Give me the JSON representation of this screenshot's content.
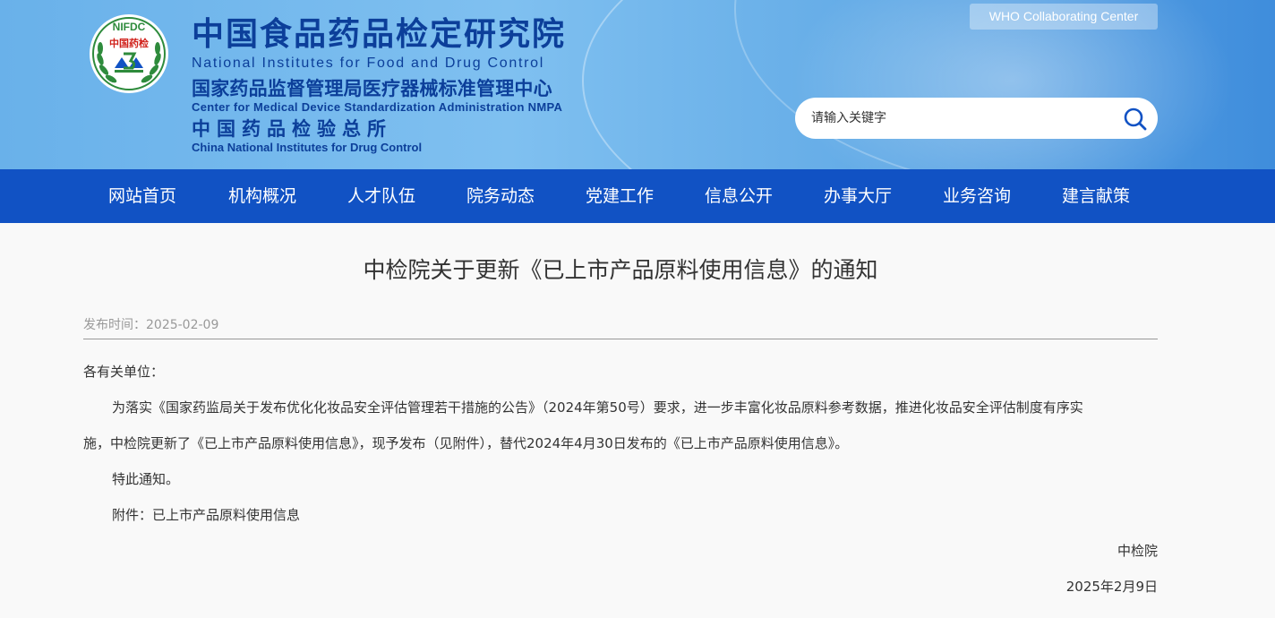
{
  "header": {
    "site_title": "中国食品药品检定研究院",
    "site_title_en": "National Institutes for Food and Drug Control",
    "sub_title": "国家药品监督管理局医疗器械标准管理中心",
    "sub_title_en": "Center for Medical Device Standardization Administration NMPA",
    "sub_title2": "中国药品检验总所",
    "sub_title2_en": "China National Institutes for Drug Control",
    "logo_text_top": "NIFDC",
    "logo_text_inner": "中国药检",
    "who_badge": "WHO Collaborating Center",
    "search_placeholder": "请输入关键字"
  },
  "nav": {
    "items": [
      {
        "label": "网站首页"
      },
      {
        "label": "机构概况"
      },
      {
        "label": "人才队伍"
      },
      {
        "label": "院务动态"
      },
      {
        "label": "党建工作"
      },
      {
        "label": "信息公开"
      },
      {
        "label": "办事大厅"
      },
      {
        "label": "业务咨询"
      },
      {
        "label": "建言献策"
      }
    ]
  },
  "article": {
    "title": "中检院关于更新《已上市产品原料使用信息》的通知",
    "date_label": "发布时间：2025-02-09",
    "salutation": "各有关单位：",
    "para1_line1": "为落实《国家药监局关于发布优化化妆品安全评估管理若干措施的公告》（2024年第50号）要求，进一步丰富化妆品原料参考数据，推进化妆品安全评估制度有序实",
    "para1_line2": "施，中检院更新了《已上市产品原料使用信息》，现予发布（见附件），替代2024年4月30日发布的《已上市产品原料使用信息》。",
    "para2": "特此通知。",
    "attachment": "附件：已上市产品原料使用信息",
    "signature": "中检院",
    "sign_date": "2025年2月9日"
  },
  "colors": {
    "nav_bg": "#1152c4",
    "title_blue": "#0c3f9a",
    "emblem_green": "#2e8b3c",
    "emblem_red": "#d0201a"
  }
}
